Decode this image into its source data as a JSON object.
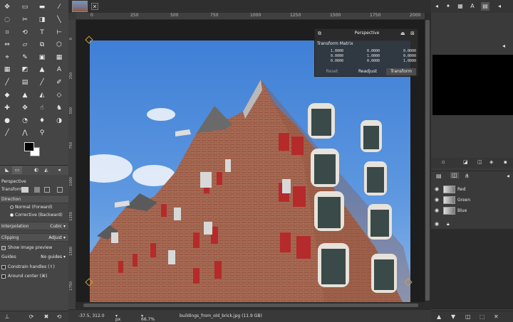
{
  "toolbox": {
    "tools": [
      "move",
      "rect-select",
      "ellipse-select",
      "lasso",
      "fuzzy-select",
      "scissors",
      "foreground-select",
      "crop",
      "unified-transform",
      "rotate",
      "scale",
      "shear",
      "perspective",
      "flip",
      "cage",
      "warp",
      "grid",
      "text",
      "bucket-fill",
      "gradient",
      "paintbrush",
      "pencil",
      "airbrush",
      "eraser",
      "clone",
      "heal",
      "smudge",
      "dodge",
      "ink",
      "mypaint",
      "blur",
      "color-picker",
      "measure",
      "zoom",
      "paths",
      "handle-transform"
    ]
  },
  "options": {
    "tool_name": "Perspective",
    "transform_label": "Transform:",
    "direction_label": "Direction",
    "direction_forward": "Normal (Forward)",
    "direction_backward": "Corrective (Backward)",
    "interpolation_label": "Interpolation",
    "interpolation_value": "Cubic",
    "clipping_label": "Clipping",
    "clipping_value": "Adjust",
    "show_preview": "Show image preview",
    "guides_label": "Guides",
    "guides_value": "No guides",
    "constrain": "Constrain handles (⇧)",
    "around_center": "Around center (⌘)"
  },
  "ruler": {
    "h_labels": [
      "0",
      "250",
      "500",
      "750",
      "1000",
      "1250",
      "1500",
      "1750",
      "2000",
      "2250"
    ],
    "v_labels": [
      "0",
      "250",
      "500",
      "750",
      "1000",
      "1250",
      "1500",
      "1750"
    ]
  },
  "dialog": {
    "title": "Perspective",
    "subtitle": "Transform Matrix",
    "matrix": [
      [
        "1.0000",
        "0.0000",
        "0.0000"
      ],
      [
        "0.0000",
        "1.0000",
        "0.0000"
      ],
      [
        "0.0000",
        "0.0000",
        "1.0000"
      ]
    ],
    "reset": "Reset",
    "readjust": "Readjust",
    "transform": "Transform"
  },
  "status": {
    "coords": "-37.5, 312.0",
    "unit": "px",
    "zoom": "66.7%",
    "filename": "buildings_from_old_brick.jpg (11.9 GB)"
  },
  "layers": [
    {
      "name": "Red"
    },
    {
      "name": "Green"
    },
    {
      "name": "Blue"
    }
  ],
  "colors": {
    "accent": "#4f86d6",
    "bg": "#3c3c3c",
    "brick": "#9a5a44",
    "shutter": "#b52a2a"
  }
}
